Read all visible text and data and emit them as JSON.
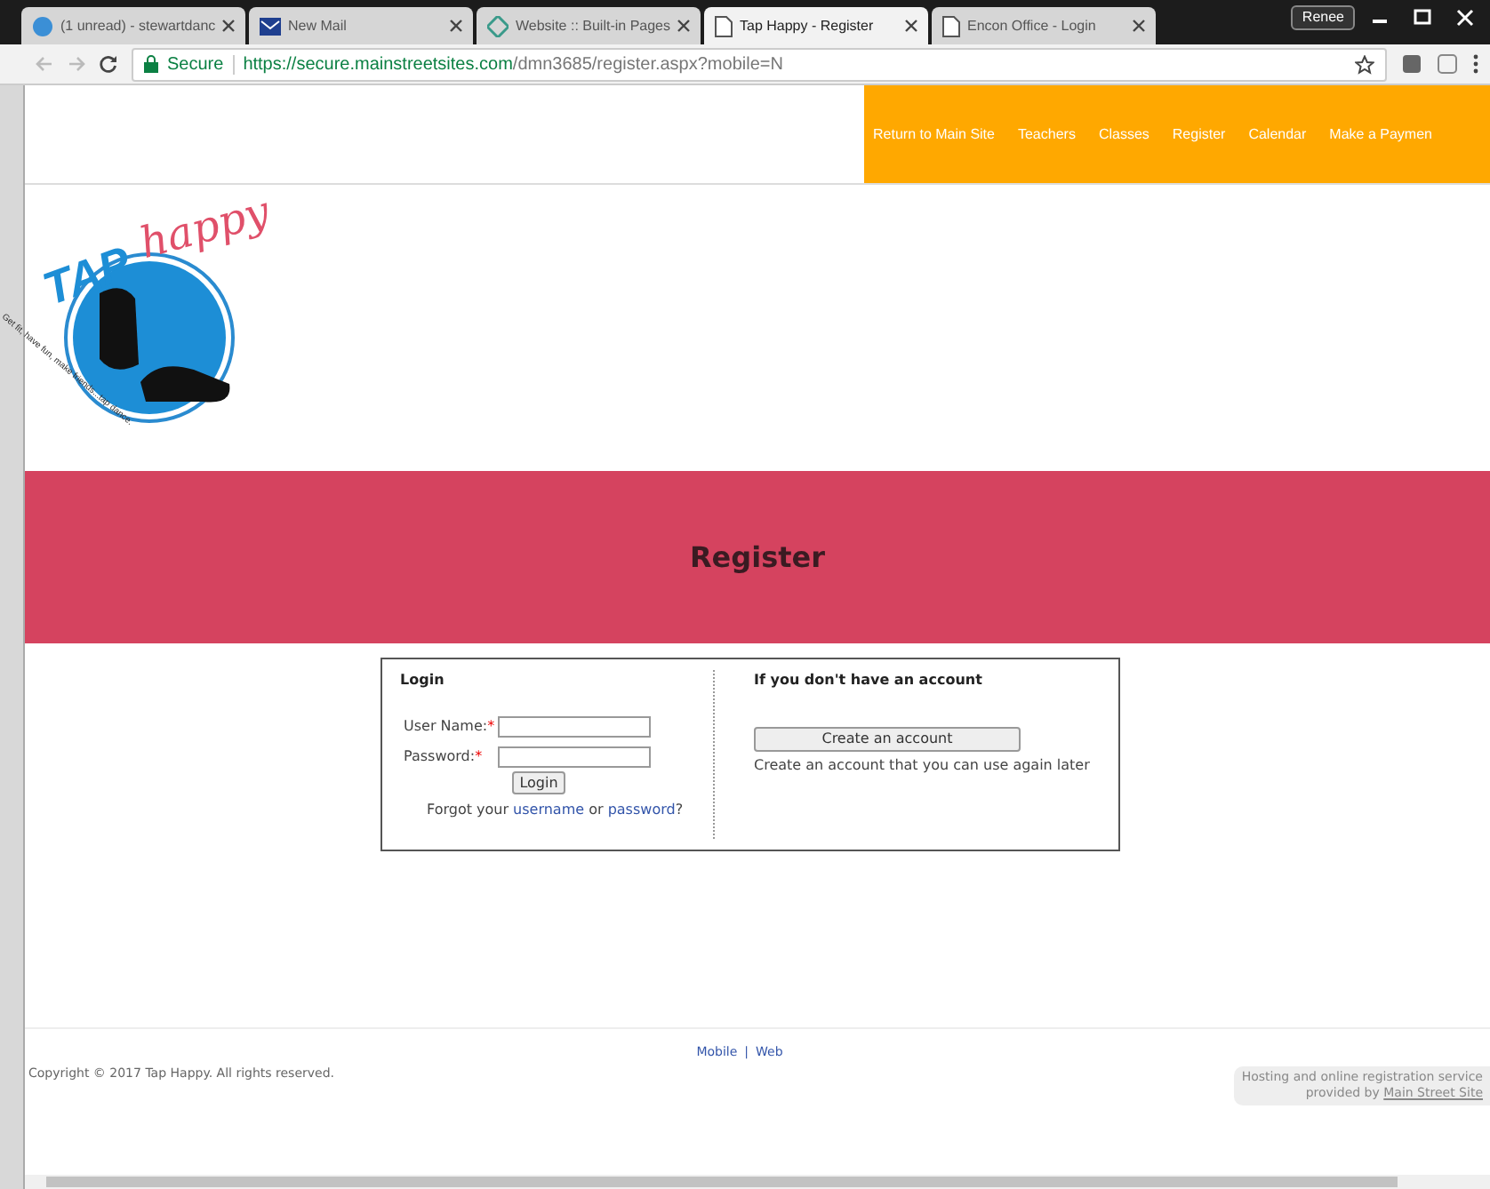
{
  "browser": {
    "tabs": [
      {
        "title": "(1 unread) - stewartdanc",
        "selected": false
      },
      {
        "title": "New Mail",
        "selected": false
      },
      {
        "title": "Website :: Built-in Pages",
        "selected": false
      },
      {
        "title": "Tap Happy - Register",
        "selected": true
      },
      {
        "title": "Encon Office - Login",
        "selected": false
      }
    ],
    "profile": "Renee",
    "secure_label": "Secure",
    "url_host": "https://secure.mainstreetsites.com",
    "url_path": "/dmn3685/register.aspx?mobile=N"
  },
  "nav": [
    "Return to Main Site",
    "Teachers",
    "Classes",
    "Register",
    "Calendar",
    "Make a Paymen"
  ],
  "logo": {
    "word1": "TAP",
    "word2": "happy",
    "tagline": "Get fit, have fun, make friends...tap dance."
  },
  "banner": {
    "title": "Register"
  },
  "login": {
    "heading": "Login",
    "fields": [
      {
        "label": "User Name:",
        "required_mark": "*"
      },
      {
        "label": "Password:",
        "required_mark": "*"
      }
    ],
    "button": "Login",
    "forgot_prefix": "Forgot your",
    "username_link": "username",
    "or": "or",
    "password_link": "password",
    "forgot_suffix": "?"
  },
  "signup": {
    "heading": "If you don't have an account",
    "button": "Create an account",
    "note": "Create an account that you can use again later"
  },
  "footer": {
    "links": [
      "Mobile",
      "Web"
    ],
    "separator": "|",
    "copyright": "Copyright © 2017 Tap Happy. All rights reserved.",
    "hosting_line1": "Hosting and online registration service",
    "hosting_line2_prefix": "provided by",
    "hosting_link": "Main Street Site"
  }
}
